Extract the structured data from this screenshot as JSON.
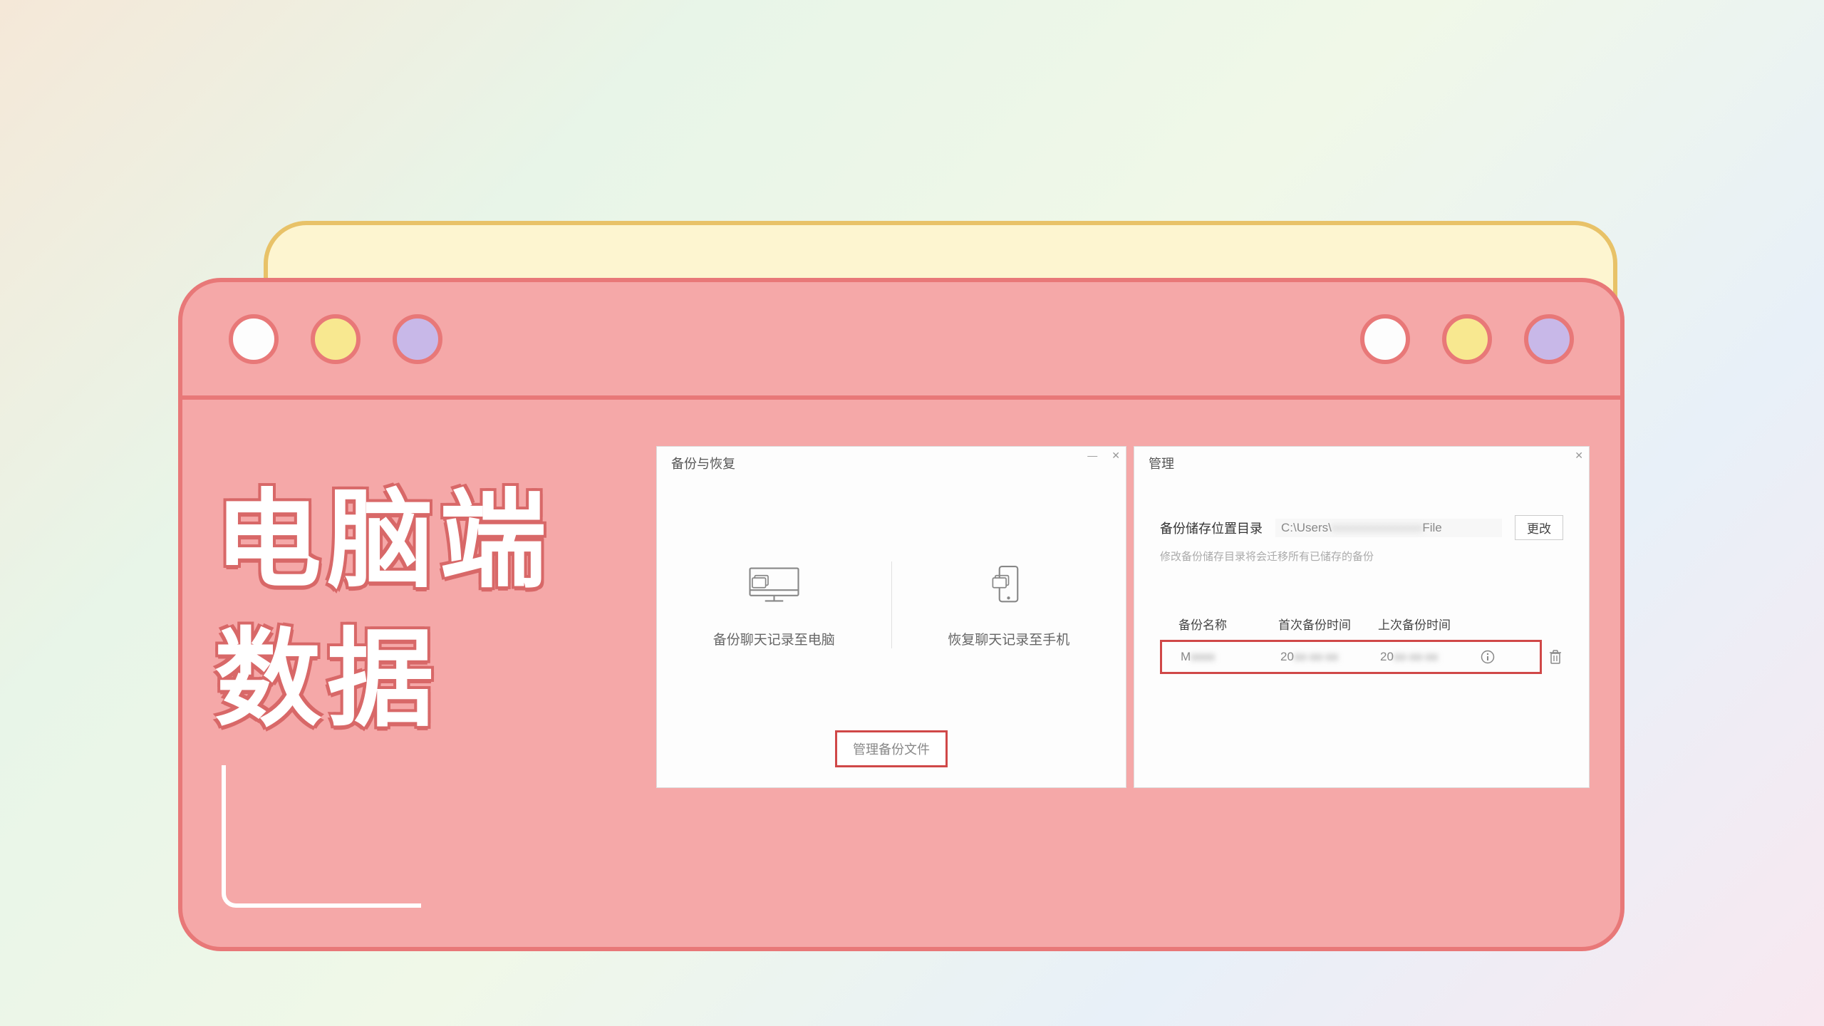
{
  "overlay": {
    "title_line1": "电脑端",
    "title_line2": "数据"
  },
  "backup_panel": {
    "title": "备份与恢复",
    "backup_to_pc": "备份聊天记录至电脑",
    "restore_to_phone": "恢复聊天记录至手机",
    "manage_button": "管理备份文件"
  },
  "manage_panel": {
    "title": "管理",
    "storage_label": "备份储存位置目录",
    "storage_path_prefix": "C:\\Users\\",
    "storage_path_suffix": "File",
    "change_button": "更改",
    "hint": "修改备份储存目录将会迁移所有已储存的备份",
    "columns": {
      "name": "备份名称",
      "first_time": "首次备份时间",
      "last_time": "上次备份时间"
    },
    "row": {
      "name_partial": "M",
      "first_partial": "20",
      "last_partial": "20"
    }
  }
}
